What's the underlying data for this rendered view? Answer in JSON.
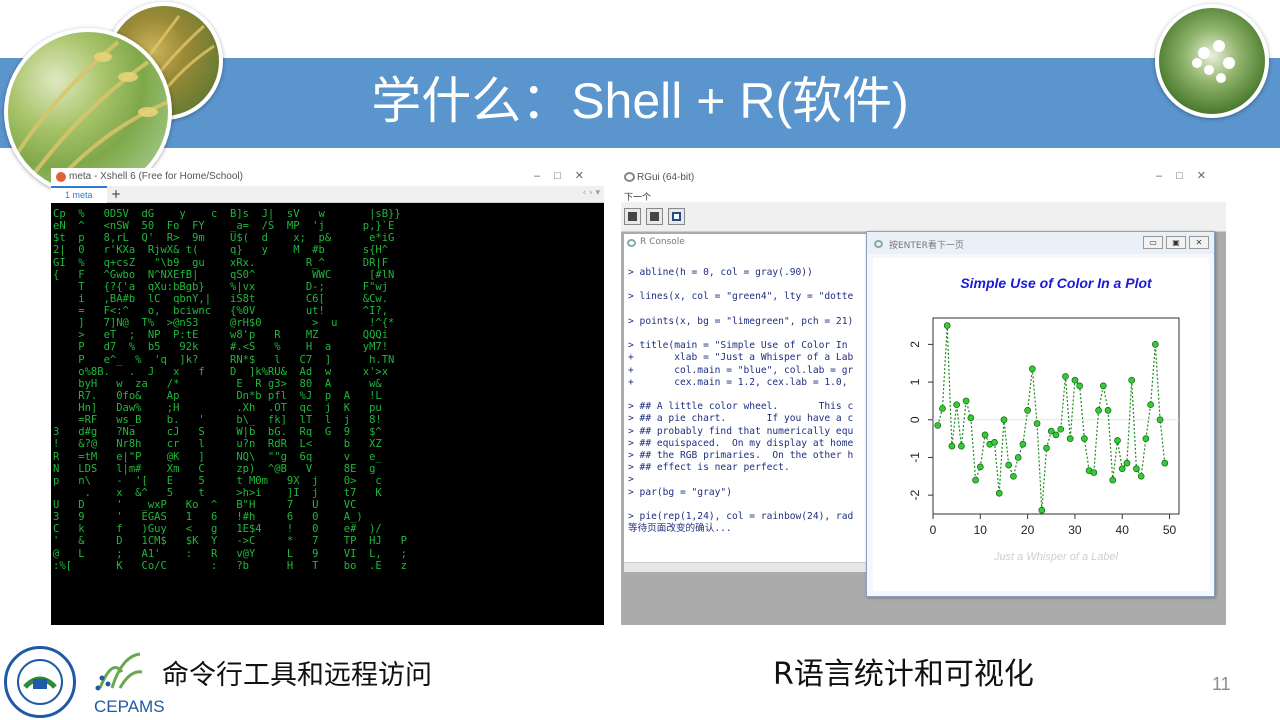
{
  "slide": {
    "title": "学什么：Shell + R(软件)",
    "caption_left": "命令行工具和远程访问",
    "caption_right": "R语言统计和可视化",
    "page_number": "11",
    "logo_text": "CEPAMS"
  },
  "xshell": {
    "window_title": "meta - Xshell 6 (Free for Home/School)",
    "tab_label": "1 meta",
    "matrix_lines": [
      "Cp  %   0D5V  dG    y    c  B]s  J|  sV   w       |sB}}",
      "eN  ^   <nSW  50  Fo  FY    _a=  /S  MP  'j      p,}`E",
      "$t  p   8,rL  Q'  R>  9m    U$(  d    x;  p&      e*iG",
      "2|  0   r'KXa  RjwX& t(     q}   y    M  #b      s{H^",
      "GI  %   q+csZ   \"\\b9  gu    xRx.        R_^      DR|F",
      "{   F   ^Gwbo  N^NXEfB|     qS0^         WWC      [#lN",
      "    T   {?{'a  qXu:bBgb}    %|vx        D-;      F\"wj",
      "    i   ,BA#b  lC  qbnY,|   iS8t        C6[      &Cw.",
      "    =   F<:^   o,  bciwnc   {%0V        ut!      ^I?,",
      "    ]   7]N@  T%  >@nS3     @rH$0        >  u     !^{*",
      "    >   eT  ;  NP  P:tE     w8'p   R    MZ       QQQi",
      "    P   d7  %  b5   92k     #.<S   %    H  a     yM7!",
      "    P   e^_  %  'q  ]k?     RN*$   l   C7  ]      h.TN",
      "    o%8B.   .  J   x   f    D  ]k%RU&  Ad  w     x'>x",
      "    byH   w  za   /*         E  R g3>  80  A      w&",
      "    R7.   0fo&    Ap         Dn*b pfl  %J  p  A   !L",
      "    Hn]   Daw%    ;H         .Xh  .OT  qc  j  K   pu",
      "    =RF   ws_B    b.   '     b\\_  fk]  lT  l  j   8!",
      "3   d#g   ?Na     cJ   S     W|b  bG.  Rq  G  9   $^",
      "!   &?@   Nr8h    cr   l     u?n  RdR  L<     b   XZ",
      "R   =tM   e|\"P    @K   ]     NQ\\  \"\"g  6q     v   e_",
      "N   LDS   l|m#    Xm   C     zp)  ^@B   V     8E  g",
      "p   n\\    -  '[   E    5     t M0m   9X  j    0>   c",
      "     .    x  &^   5    t     >h>i    ]I  j    t7   K",
      "U   D     '   _wxP   Ko  ^   B\"H     7   U    VC",
      "3   9     '   EGAS   1   6   !#h     6   0    A_)",
      "C   k     f   )Guy   <   g   1E$4    !   0    e#  )/",
      "'   &     D   1CM$   $K  Y   ->C     *   7    TP  HJ   P",
      "@   L     ;   A1'    :   R   v@Y     L   9    VI  L,   ;",
      ":%[       K   Co/C       :   ?b      H   T    bo  .E   z"
    ]
  },
  "rgui": {
    "window_title": "RGui (64-bit)",
    "menu_label": "下一个",
    "console_title": "R Console",
    "console_lines": [
      "> abline(h = 0, col = gray(.90))",
      "",
      "> lines(x, col = \"green4\", lty = \"dotte",
      "",
      "> points(x, bg = \"limegreen\", pch = 21)",
      "",
      "> title(main = \"Simple Use of Color In",
      "+       xlab = \"Just a Whisper of a Lab",
      "+       col.main = \"blue\", col.lab = gr",
      "+       cex.main = 1.2, cex.lab = 1.0,",
      "",
      "> ## A little color wheel.       This c",
      "> ## a pie chart.       If you have a c",
      "> ## probably find that numerically equ",
      "> ## equispaced.  On my display at home",
      "> ## the RGB primaries.  On the other h",
      "> ## effect is near perfect.",
      ">",
      "> par(bg = \"gray\")",
      "",
      "> pie(rep(1,24), col = rainbow(24), rad",
      "等待页面改变的确认..."
    ],
    "graphics_title": "按ENTER看下一页"
  },
  "chart_data": {
    "type": "line",
    "title": "Simple Use of Color In a Plot",
    "xlabel": "Just a Whisper of a Label",
    "ylabel": "",
    "xlim": [
      0,
      52
    ],
    "ylim": [
      -2.5,
      2.7
    ],
    "xticks": [
      0,
      10,
      20,
      30,
      40,
      50
    ],
    "yticks": [
      -2,
      -1,
      0,
      1,
      2
    ],
    "title_color": "#1a1ad6",
    "line_color": "#1e8a1e",
    "point_color": "#32cd32",
    "x": [
      1,
      2,
      3,
      4,
      5,
      6,
      7,
      8,
      9,
      10,
      11,
      12,
      13,
      14,
      15,
      16,
      17,
      18,
      19,
      20,
      21,
      22,
      23,
      24,
      25,
      26,
      27,
      28,
      29,
      30,
      31,
      32,
      33,
      34,
      35,
      36,
      37,
      38,
      39,
      40,
      41,
      42,
      43,
      44,
      45,
      46,
      47,
      48,
      49,
      50
    ],
    "y": [
      -0.15,
      0.3,
      2.5,
      -0.7,
      0.4,
      -0.7,
      0.5,
      0.05,
      -1.6,
      -1.25,
      -0.4,
      -0.65,
      -0.6,
      -1.95,
      0.0,
      -1.2,
      -1.5,
      -1.0,
      -0.65,
      0.25,
      1.35,
      -0.1,
      -2.4,
      -0.75,
      -0.3,
      -0.4,
      -0.25,
      1.15,
      -0.5,
      1.05,
      0.9,
      -0.5,
      -1.35,
      -1.4,
      0.25,
      0.9,
      0.25,
      -1.6,
      -0.55,
      -1.3,
      -1.15,
      1.05,
      -1.3,
      -1.5,
      -0.5,
      0.4,
      2.0,
      0.0,
      -1.15
    ]
  }
}
